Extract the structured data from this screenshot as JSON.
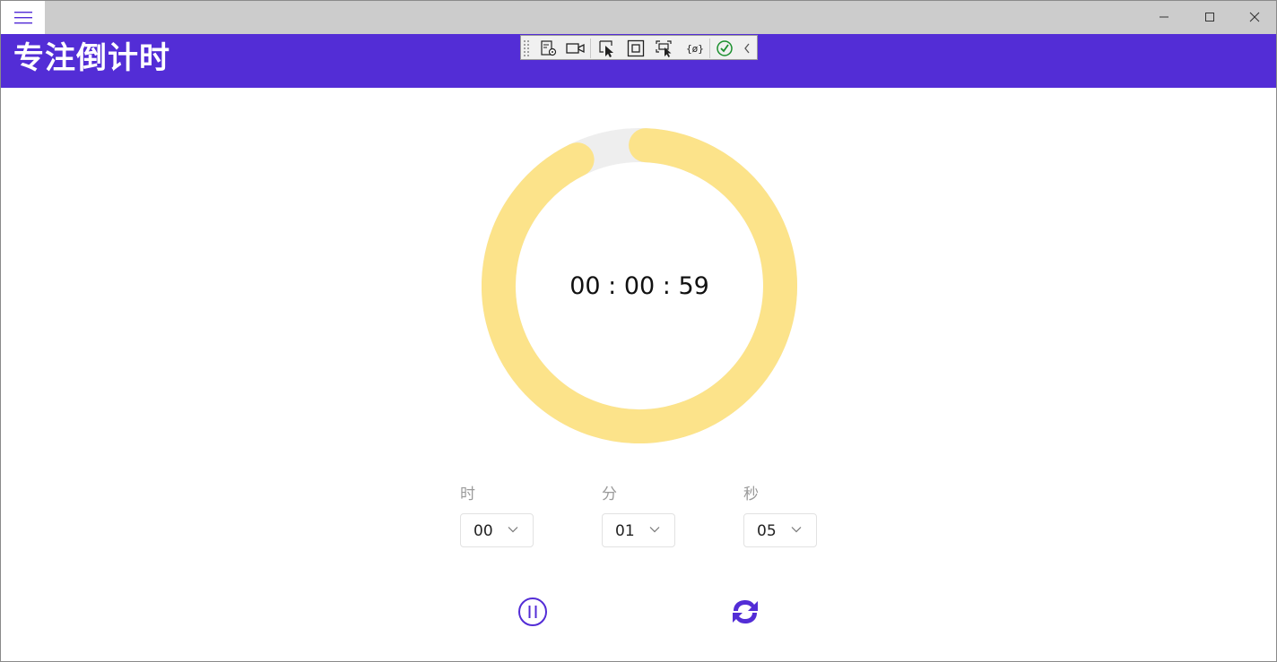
{
  "app": {
    "title": "专注倒计时"
  },
  "titlebar": {
    "menu_icon": "hamburger-icon",
    "window_buttons": [
      "minimize-icon",
      "maximize-icon",
      "close-icon"
    ]
  },
  "debug_toolbar": {
    "icons": [
      "live-visual-tree-icon",
      "record-icon",
      "select-element-icon",
      "display-layout-adorners-icon",
      "track-focused-element-icon",
      "binding-failures-icon",
      "hot-reload-ok-icon",
      "collapse-icon"
    ]
  },
  "timer": {
    "display": "00 : 00 : 59",
    "progress_fraction": 0.92,
    "colors": {
      "ring": "#fce38a",
      "track": "#eeeeee"
    }
  },
  "pickers": [
    {
      "label": "时",
      "value": "00"
    },
    {
      "label": "分",
      "value": "01"
    },
    {
      "label": "秒",
      "value": "05"
    }
  ],
  "controls": {
    "pause_icon": "pause-icon",
    "reset_icon": "refresh-icon",
    "accent_color": "#532dd6"
  }
}
